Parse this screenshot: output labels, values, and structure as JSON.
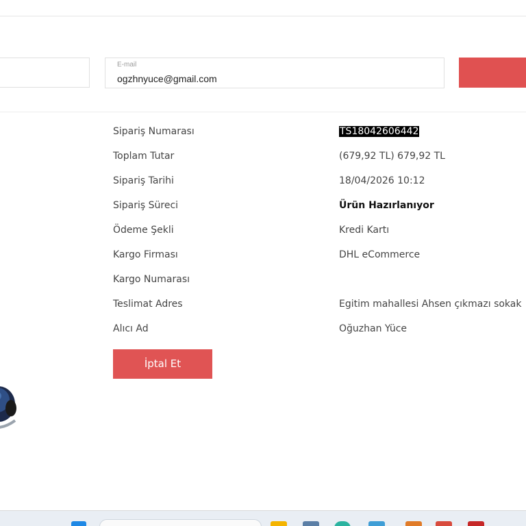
{
  "form": {
    "email_label": "E-mail",
    "email_value": "ogzhnyuce@gmail.com"
  },
  "order_details": [
    {
      "label": "Sipariş Numarası",
      "value": "TS18042606442"
    },
    {
      "label": "Toplam Tutar",
      "value": "(679,92 TL) 679,92 TL"
    },
    {
      "label": "Sipariş Tarihi",
      "value": "18/04/2026 10:12"
    },
    {
      "label": "Sipariş Süreci",
      "value": "Ürün Hazırlanıyor"
    },
    {
      "label": "Ödeme Şekli",
      "value": "Kredi Kartı"
    },
    {
      "label": "Kargo Firması",
      "value": "DHL eCommerce"
    },
    {
      "label": "Kargo Numarası",
      "value": ""
    },
    {
      "label": "Teslimat Adres",
      "value": "Egitim mahallesi Ahsen çıkmazı sokak"
    },
    {
      "label": "Alıcı Ad",
      "value": "Oğuzhan Yüce"
    }
  ],
  "actions": {
    "cancel_label": "İptal Et"
  },
  "colors": {
    "accent_red": "#e05454",
    "border": "#e0e0e0"
  },
  "taskbar": {
    "icons": [
      "windows-start-icon",
      "search-box",
      "task-view-icon",
      "file-explorer-icon",
      "edge-browser-icon",
      "app-icon",
      "store-icon",
      "mail-icon",
      "app-icon-red"
    ]
  }
}
